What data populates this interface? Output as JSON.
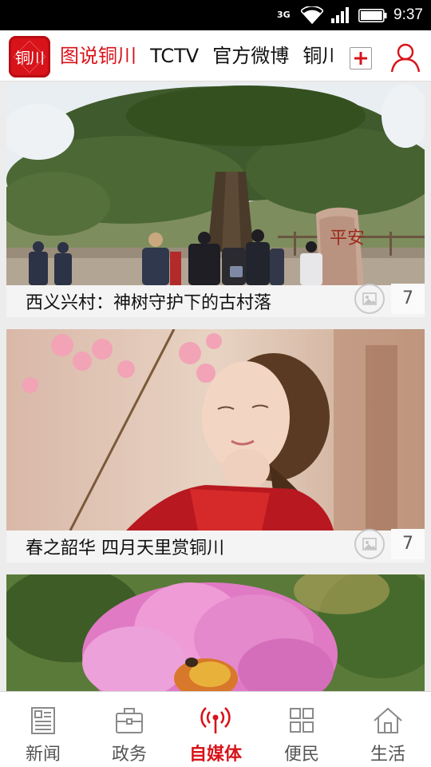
{
  "status_bar": {
    "network": "3G",
    "time": "9:37"
  },
  "header": {
    "logo_text": "铜川",
    "tabs": [
      {
        "label": "图说铜川",
        "active": true
      },
      {
        "label": "TCTV",
        "active": false
      },
      {
        "label": "官方微博",
        "active": false
      },
      {
        "label": "铜川",
        "active": false
      }
    ],
    "add_icon": "plus-icon",
    "user_icon": "user-icon"
  },
  "feed": {
    "items": [
      {
        "title": "西义兴村：神树守护下的古村落",
        "photo_count": "7",
        "photo": "village-ancient-tree-photo",
        "stone_text": "平安"
      },
      {
        "title": "春之韶华 四月天里赏铜川",
        "photo_count": "7",
        "photo": "woman-blossom-photo"
      },
      {
        "title": "",
        "photo_count": "",
        "photo": "pink-peony-photo"
      }
    ]
  },
  "bottom_nav": {
    "items": [
      {
        "label": "新闻",
        "icon": "newspaper-icon",
        "active": false
      },
      {
        "label": "政务",
        "icon": "briefcase-icon",
        "active": false
      },
      {
        "label": "自媒体",
        "icon": "broadcast-icon",
        "active": true
      },
      {
        "label": "便民",
        "icon": "grid-icon",
        "active": false
      },
      {
        "label": "生活",
        "icon": "house-icon",
        "active": false
      }
    ]
  },
  "colors": {
    "brand_red": "#d8131a",
    "nav_inactive": "#555555",
    "caption_bg": "#f4f4f4"
  }
}
